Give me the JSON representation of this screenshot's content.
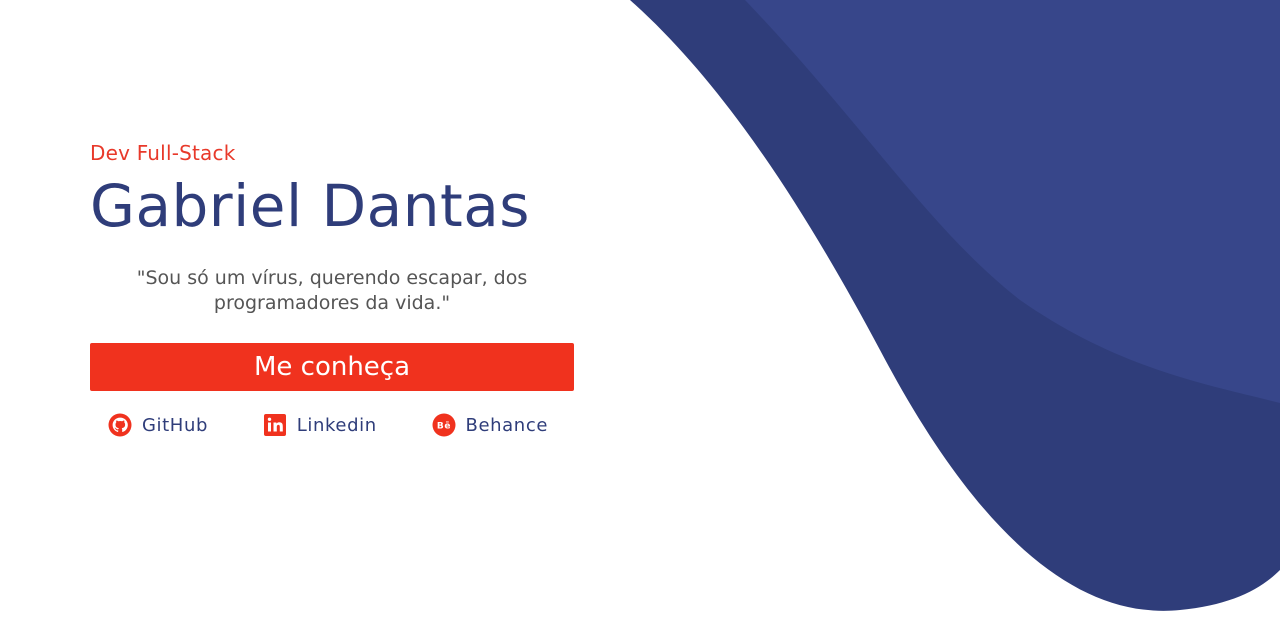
{
  "hero": {
    "role": "Dev Full-Stack",
    "name": "Gabriel Dantas",
    "quote": "\"Sou só um vírus, querendo escapar, dos programadores da vida.\"",
    "cta_label": "Me conheça"
  },
  "socials": [
    {
      "label": "GitHub",
      "icon": "github-icon"
    },
    {
      "label": "Linkedin",
      "icon": "linkedin-icon"
    },
    {
      "label": "Behance",
      "icon": "behance-icon"
    }
  ],
  "colors": {
    "accent": "#f0321e",
    "brand_dark": "#2f3d7a",
    "wave_back": "#2f3d7a",
    "wave_front": "#37468a",
    "quote_text": "#555555"
  }
}
